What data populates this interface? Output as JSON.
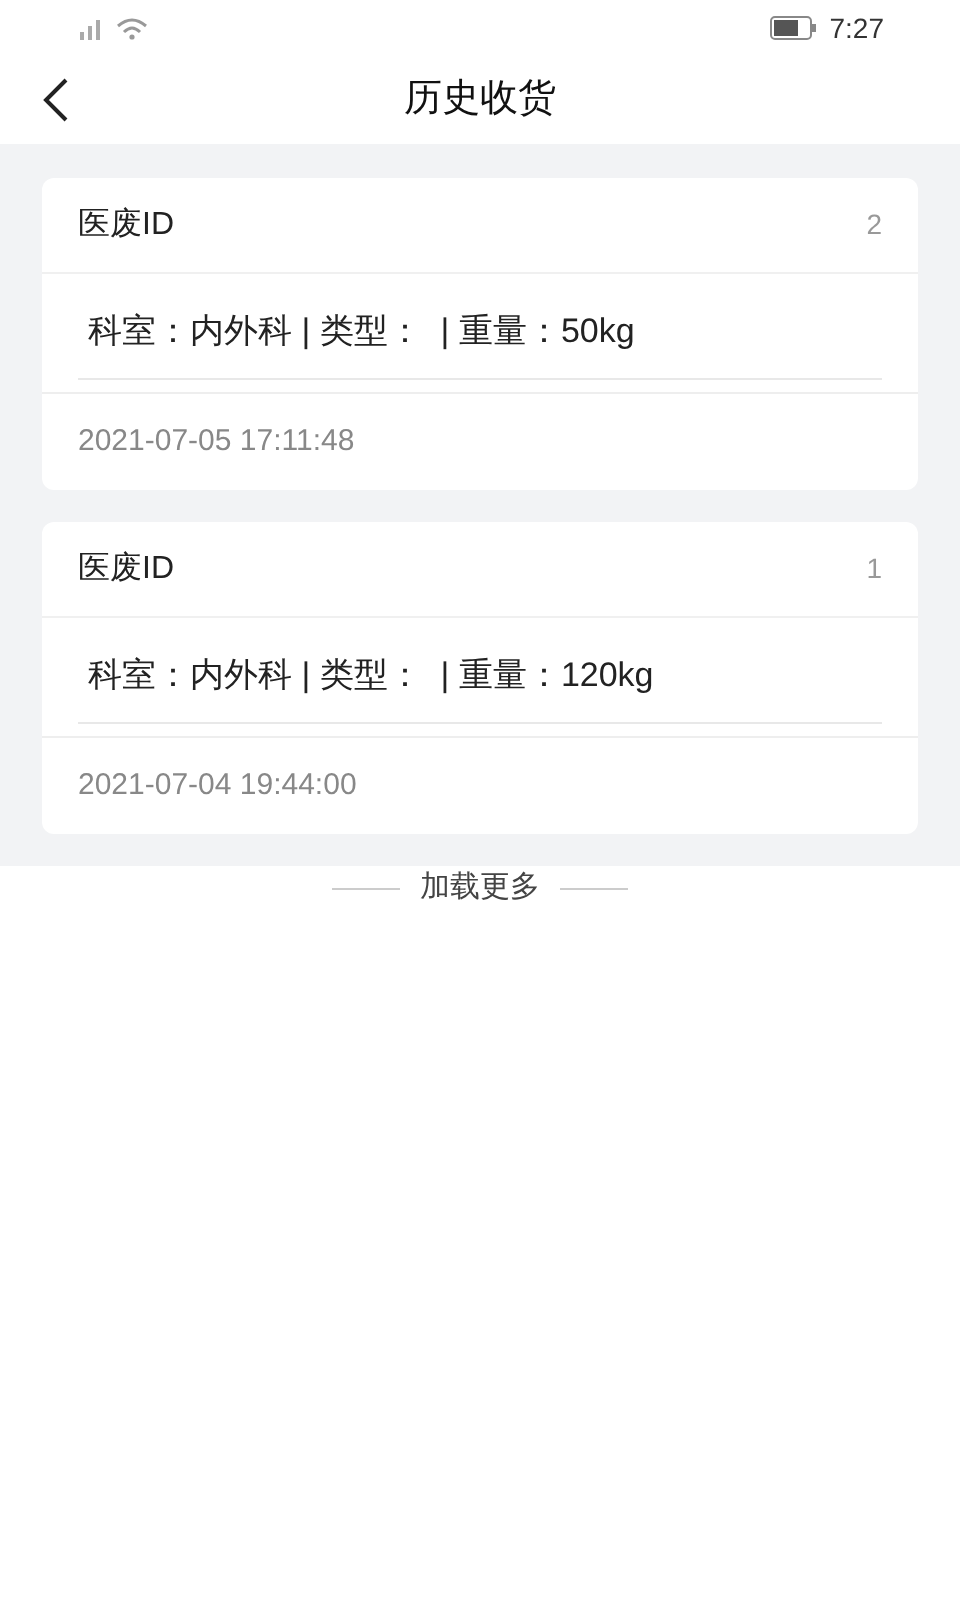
{
  "status_bar": {
    "time": "7:27"
  },
  "header": {
    "title": "历史收货"
  },
  "records": [
    {
      "label": "医废ID",
      "number": "2",
      "details": "科室：内外科 | 类型：  | 重量：50kg",
      "time": "2021-07-05 17:11:48"
    },
    {
      "label": "医废ID",
      "number": "1",
      "details": "科室：内外科 | 类型：  | 重量：120kg",
      "time": "2021-07-04 19:44:00"
    }
  ],
  "load_more": "加载更多"
}
